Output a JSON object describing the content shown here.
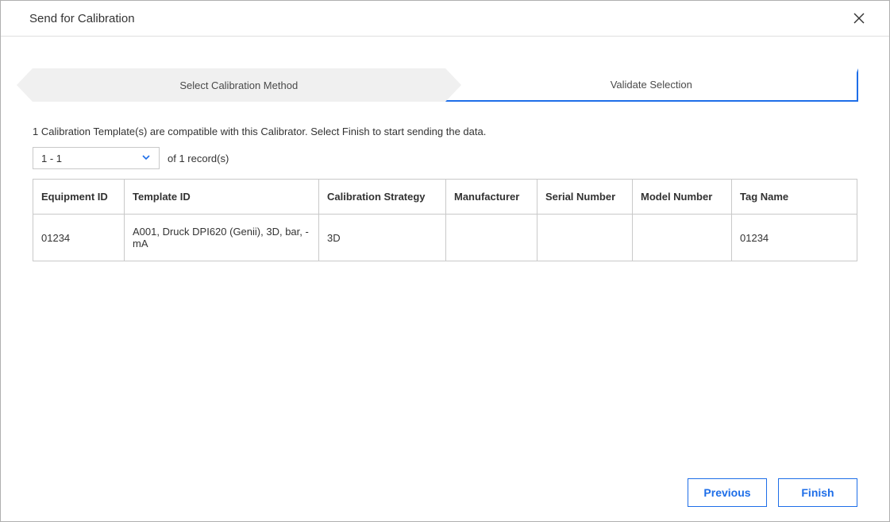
{
  "modal": {
    "title": "Send for Calibration"
  },
  "wizard": {
    "step1": "Select Calibration Method",
    "step2": "Validate Selection"
  },
  "instruction": "1 Calibration Template(s) are compatible with this Calibrator. Select Finish to start sending the data.",
  "pager": {
    "range": "1 - 1",
    "records_text": "of 1 record(s)"
  },
  "table": {
    "headers": {
      "equipment_id": "Equipment ID",
      "template_id": "Template ID",
      "calibration_strategy": "Calibration Strategy",
      "manufacturer": "Manufacturer",
      "serial_number": "Serial Number",
      "model_number": "Model Number",
      "tag_name": "Tag Name"
    },
    "rows": [
      {
        "equipment_id": "01234",
        "template_id": "A001, Druck DPI620 (Genii), 3D, bar, - mA",
        "calibration_strategy": "3D",
        "manufacturer": "",
        "serial_number": "",
        "model_number": "",
        "tag_name": "01234"
      }
    ]
  },
  "buttons": {
    "previous": "Previous",
    "finish": "Finish"
  }
}
